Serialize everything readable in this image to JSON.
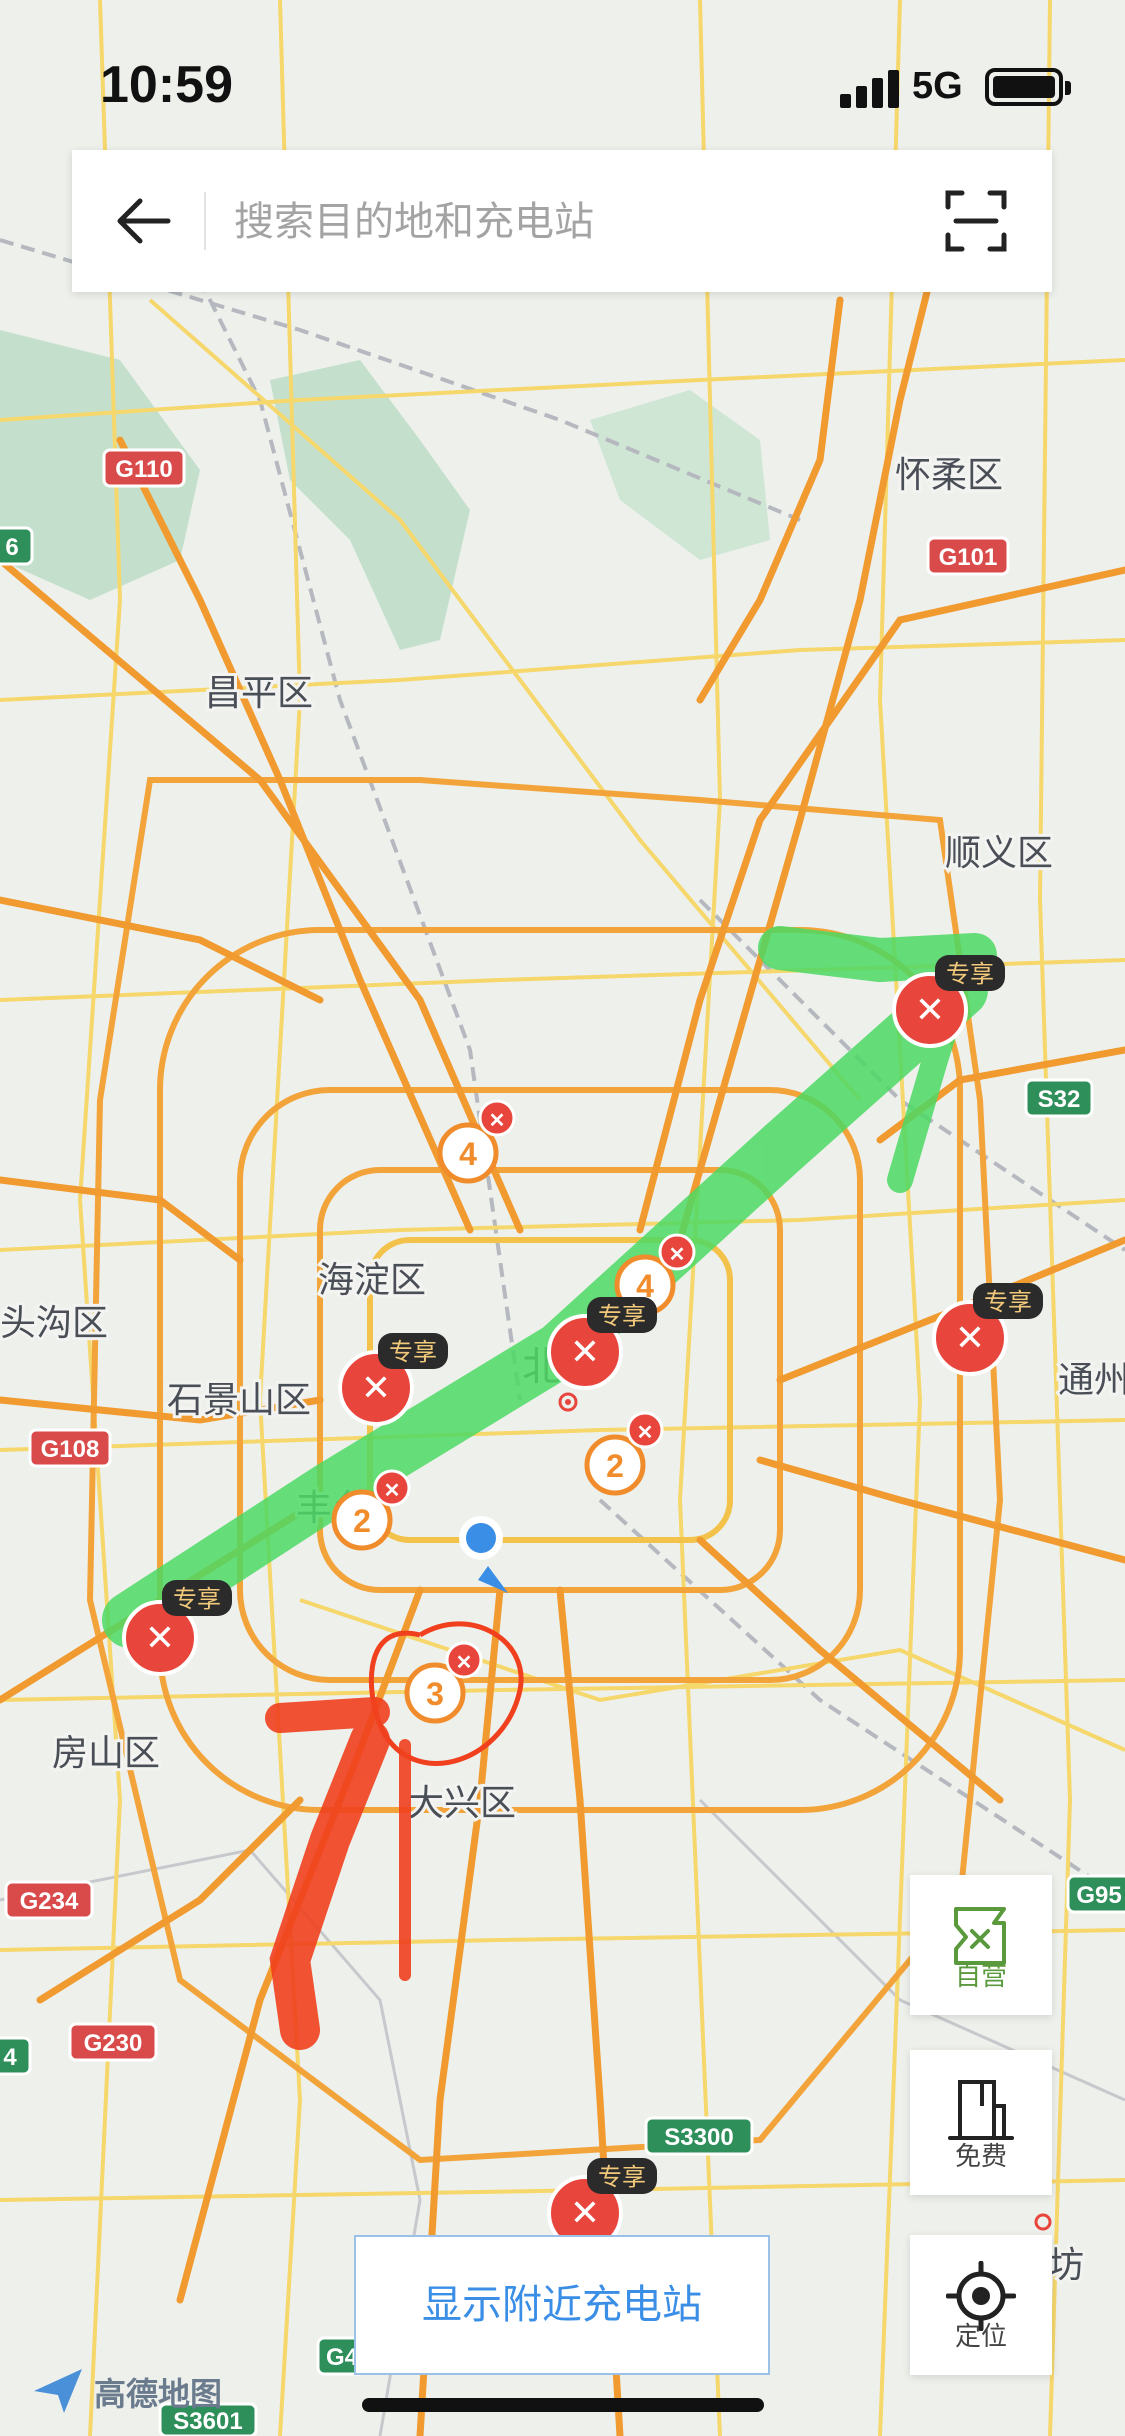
{
  "status_bar": {
    "time": "10:59",
    "network": "5G"
  },
  "search": {
    "placeholder": "搜索目的地和充电站"
  },
  "map": {
    "district_labels": [
      {
        "id": "huairou",
        "text": "怀柔区"
      },
      {
        "id": "changping",
        "text": "昌平区"
      },
      {
        "id": "shunyi",
        "text": "顺义区"
      },
      {
        "id": "haidian",
        "text": "海淀区"
      },
      {
        "id": "mentougou",
        "text": "头沟区"
      },
      {
        "id": "shijingshan",
        "text": "石景山区"
      },
      {
        "id": "beijing",
        "text": "北京"
      },
      {
        "id": "tongzhou",
        "text": "通州"
      },
      {
        "id": "fengtai",
        "text": "丰台"
      },
      {
        "id": "fangshan",
        "text": "房山区"
      },
      {
        "id": "daxing",
        "text": "大兴区"
      },
      {
        "id": "langfang",
        "text": "坊"
      }
    ],
    "road_shields": [
      {
        "id": "g110",
        "text": "G110",
        "color": "#d94a4a"
      },
      {
        "id": "g101",
        "text": "G101",
        "color": "#d94a4a"
      },
      {
        "id": "s32",
        "text": "S32",
        "color": "#2f8f5b"
      },
      {
        "id": "g108",
        "text": "G108",
        "color": "#d94a4a"
      },
      {
        "id": "g234",
        "text": "G234",
        "color": "#d94a4a"
      },
      {
        "id": "g230",
        "text": "G230",
        "color": "#d94a4a"
      },
      {
        "id": "g95",
        "text": "G95",
        "color": "#2f8f5b"
      },
      {
        "id": "s3300",
        "text": "S3300",
        "color": "#2f8f5b"
      },
      {
        "id": "s3601",
        "text": "S3601",
        "color": "#2f8f5b"
      },
      {
        "id": "g4",
        "text": "G4",
        "color": "#2f8f5b"
      },
      {
        "id": "g6",
        "text": "6",
        "color": "#2f8f5b"
      },
      {
        "id": "g4b",
        "text": "4",
        "color": "#2f8f5b"
      }
    ],
    "cluster_markers": [
      {
        "id": "c4-north",
        "count": "4"
      },
      {
        "id": "c4-center",
        "count": "4"
      },
      {
        "id": "c2-east",
        "count": "2"
      },
      {
        "id": "c2-west",
        "count": "2"
      },
      {
        "id": "c3-south",
        "count": "3"
      }
    ],
    "exclusive_markers": [
      {
        "id": "shunyi",
        "badge": "专享"
      },
      {
        "id": "tongzhou",
        "badge": "专享"
      },
      {
        "id": "shijingshan",
        "badge": "专享"
      },
      {
        "id": "center",
        "badge": "专享"
      },
      {
        "id": "fangshan",
        "badge": "专享"
      },
      {
        "id": "south",
        "badge": "专享"
      }
    ],
    "colors": {
      "brand": "#e8453c",
      "cluster": "#f08c2b",
      "annotation_green": "#4cd964",
      "annotation_red": "#f0401e",
      "location": "#3a8ee6"
    }
  },
  "side_buttons": {
    "self_operated": "自营",
    "free": "免费",
    "locate": "定位"
  },
  "bottom": {
    "nearby_button": "显示附近充电站"
  },
  "logo": {
    "text": "高德地图"
  }
}
